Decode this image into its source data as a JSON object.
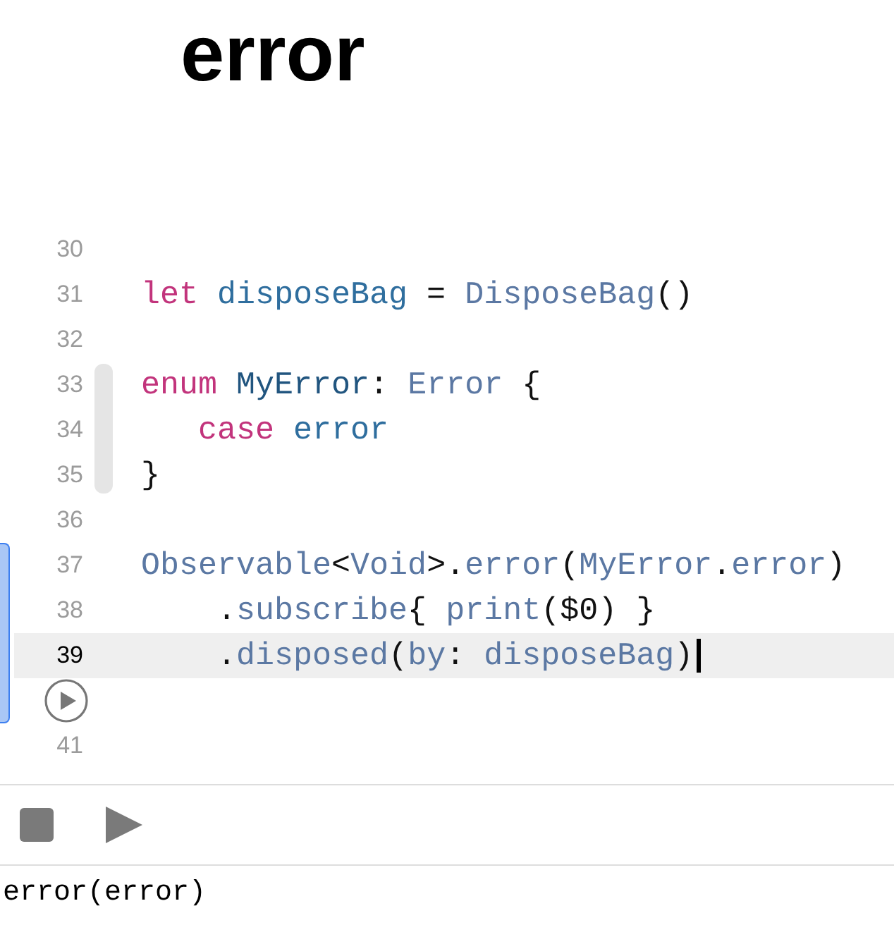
{
  "title": "error",
  "lines": [
    {
      "number": "30",
      "current": false
    },
    {
      "number": "31",
      "current": false,
      "tokens": [
        {
          "text": "let",
          "kind": "keyword"
        },
        {
          "text": " disposeBag",
          "kind": "declaration"
        },
        {
          "text": " = ",
          "kind": "plain"
        },
        {
          "text": "DisposeBag",
          "kind": "reference"
        },
        {
          "text": "()",
          "kind": "plain"
        }
      ]
    },
    {
      "number": "32",
      "current": false
    },
    {
      "number": "33",
      "current": false,
      "tokens": [
        {
          "text": "enum",
          "kind": "keyword"
        },
        {
          "text": " MyError",
          "kind": "type"
        },
        {
          "text": ": ",
          "kind": "plain"
        },
        {
          "text": "Error",
          "kind": "reference"
        },
        {
          "text": " {",
          "kind": "plain"
        }
      ]
    },
    {
      "number": "34",
      "current": false,
      "tokens": [
        {
          "text": "   case",
          "kind": "keyword"
        },
        {
          "text": " error",
          "kind": "declaration"
        }
      ]
    },
    {
      "number": "35",
      "current": false,
      "tokens": [
        {
          "text": "}",
          "kind": "plain"
        }
      ]
    },
    {
      "number": "36",
      "current": false
    },
    {
      "number": "37",
      "current": false,
      "tokens": [
        {
          "text": "Observable",
          "kind": "reference"
        },
        {
          "text": "<",
          "kind": "plain"
        },
        {
          "text": "Void",
          "kind": "reference"
        },
        {
          "text": ">.",
          "kind": "plain"
        },
        {
          "text": "error",
          "kind": "reference"
        },
        {
          "text": "(",
          "kind": "plain"
        },
        {
          "text": "MyError",
          "kind": "reference"
        },
        {
          "text": ".",
          "kind": "plain"
        },
        {
          "text": "error",
          "kind": "reference"
        },
        {
          "text": ")",
          "kind": "plain"
        }
      ]
    },
    {
      "number": "38",
      "current": false,
      "tokens": [
        {
          "text": "    .",
          "kind": "plain"
        },
        {
          "text": "subscribe",
          "kind": "reference"
        },
        {
          "text": "{ ",
          "kind": "plain"
        },
        {
          "text": "print",
          "kind": "reference"
        },
        {
          "text": "($0) }",
          "kind": "plain"
        }
      ]
    },
    {
      "number": "39",
      "current": true,
      "tokens": [
        {
          "text": "    .",
          "kind": "plain"
        },
        {
          "text": "disposed",
          "kind": "reference"
        },
        {
          "text": "(",
          "kind": "plain"
        },
        {
          "text": "by",
          "kind": "reference"
        },
        {
          "text": ": ",
          "kind": "plain"
        },
        {
          "text": "disposeBag",
          "kind": "reference"
        },
        {
          "text": ")",
          "kind": "plain"
        }
      ]
    },
    {
      "kind": "run-marker",
      "current": false
    },
    {
      "number": "41",
      "current": false
    }
  ],
  "console_output": "error(error)"
}
